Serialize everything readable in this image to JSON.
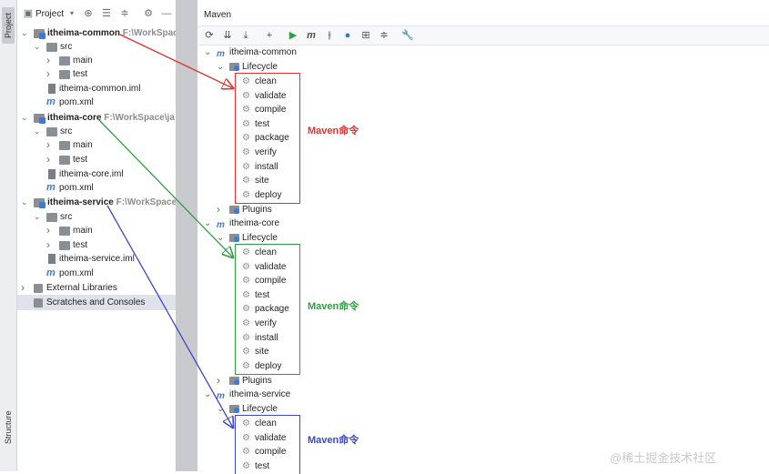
{
  "left_strip": {
    "project_tab": "Project",
    "structure_tab": "Structure"
  },
  "project_panel": {
    "title": "Project",
    "tree": [
      {
        "label": "itheima-common",
        "path": "F:\\WorkSpace",
        "kind": "module"
      },
      {
        "label": "src",
        "kind": "folder"
      },
      {
        "label": "main",
        "kind": "folder"
      },
      {
        "label": "test",
        "kind": "folder"
      },
      {
        "label": "itheima-common.iml",
        "kind": "iml"
      },
      {
        "label": "pom.xml",
        "kind": "pom"
      },
      {
        "label": "itheima-core",
        "path": "F:\\WorkSpace\\ja",
        "kind": "module"
      },
      {
        "label": "src",
        "kind": "folder"
      },
      {
        "label": "main",
        "kind": "folder"
      },
      {
        "label": "test",
        "kind": "folder"
      },
      {
        "label": "itheima-core.iml",
        "kind": "iml"
      },
      {
        "label": "pom.xml",
        "kind": "pom"
      },
      {
        "label": "itheima-service",
        "path": "F:\\WorkSpace",
        "kind": "module"
      },
      {
        "label": "src",
        "kind": "folder"
      },
      {
        "label": "main",
        "kind": "folder"
      },
      {
        "label": "test",
        "kind": "folder"
      },
      {
        "label": "itheima-service.iml",
        "kind": "iml"
      },
      {
        "label": "pom.xml",
        "kind": "pom"
      },
      {
        "label": "External Libraries",
        "kind": "libs"
      },
      {
        "label": "Scratches and Consoles",
        "kind": "scratch"
      }
    ]
  },
  "maven_panel": {
    "title": "Maven",
    "projects": [
      {
        "name": "itheima-common",
        "lifecycle_label": "Lifecycle",
        "plugins_label": "Plugins",
        "goals": [
          "clean",
          "validate",
          "compile",
          "test",
          "package",
          "verify",
          "install",
          "site",
          "deploy"
        ]
      },
      {
        "name": "itheima-core",
        "lifecycle_label": "Lifecycle",
        "plugins_label": "Plugins",
        "goals": [
          "clean",
          "validate",
          "compile",
          "test",
          "package",
          "verify",
          "install",
          "site",
          "deploy"
        ]
      },
      {
        "name": "itheima-service",
        "lifecycle_label": "Lifecycle",
        "goals": [
          "clean",
          "validate",
          "compile",
          "test"
        ]
      }
    ]
  },
  "annotations": [
    {
      "text": "Maven命令",
      "color": "#e03131"
    },
    {
      "text": "Maven命令",
      "color": "#2f9e44"
    },
    {
      "text": "Maven命令",
      "color": "#3b48c8"
    }
  ],
  "watermark": "@稀土掘金技术社区",
  "colors": {
    "red": "#e03131",
    "green": "#2f9e44",
    "blue": "#3b48c8",
    "accent": "#3d7ad6"
  }
}
